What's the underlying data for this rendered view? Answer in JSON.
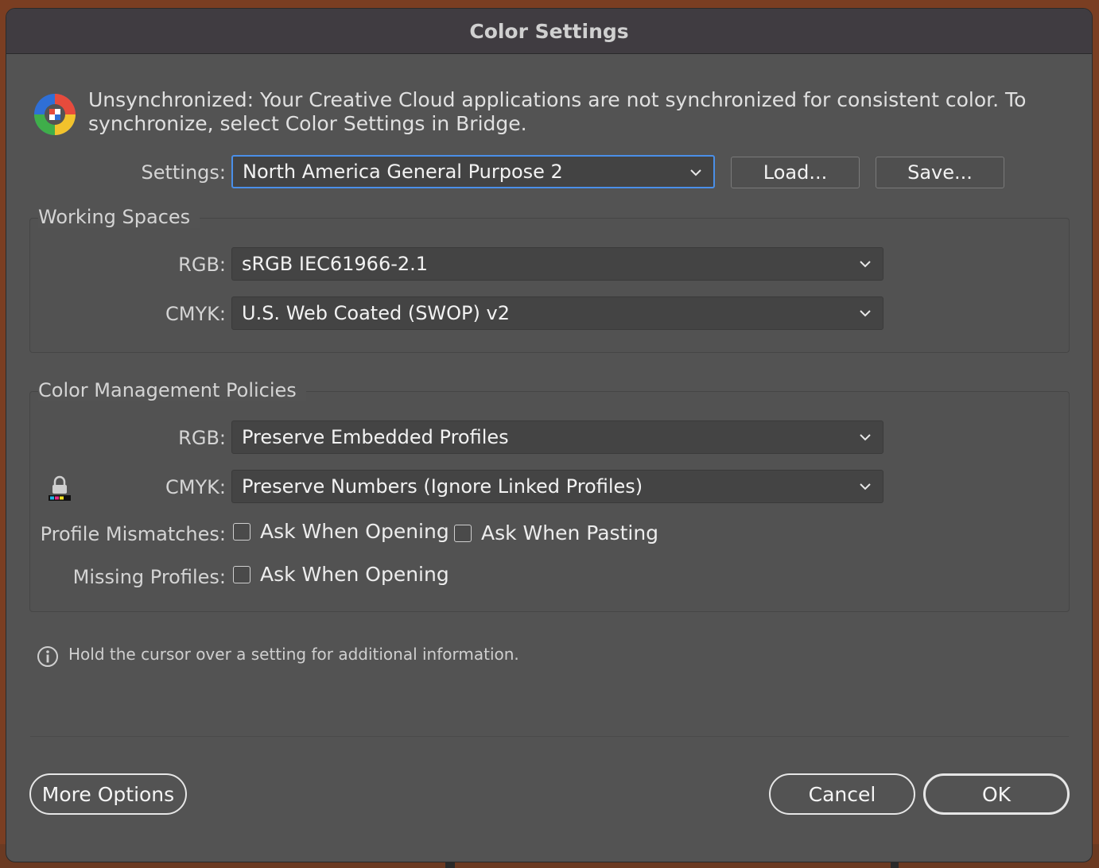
{
  "window": {
    "title": "Color Settings"
  },
  "sync": {
    "icon": "color-sync-icon",
    "message": "Unsynchronized: Your Creative Cloud applications are not synchronized for consistent color. To synchronize, select Color Settings in Bridge."
  },
  "settings": {
    "label": "Settings:",
    "value": "North America General Purpose 2",
    "load_label": "Load...",
    "save_label": "Save..."
  },
  "working_spaces": {
    "title": "Working Spaces",
    "rgb_label": "RGB:",
    "rgb_value": "sRGB IEC61966-2.1",
    "cmyk_label": "CMYK:",
    "cmyk_value": "U.S. Web Coated (SWOP) v2"
  },
  "policies": {
    "title": "Color Management Policies",
    "rgb_label": "RGB:",
    "rgb_value": "Preserve Embedded Profiles",
    "cmyk_label": "CMYK:",
    "cmyk_value": "Preserve Numbers (Ignore Linked Profiles)",
    "mismatch_label": "Profile Mismatches:",
    "mismatch_opening": {
      "label": "Ask When Opening",
      "checked": false
    },
    "mismatch_pasting": {
      "label": "Ask When Pasting",
      "checked": false
    },
    "missing_label": "Missing Profiles:",
    "missing_opening": {
      "label": "Ask When Opening",
      "checked": false
    }
  },
  "info": {
    "text": "Hold the cursor over a setting for additional information."
  },
  "footer": {
    "more_options": "More Options",
    "cancel": "Cancel",
    "ok": "OK"
  },
  "colors": {
    "dialog_bg": "#535353",
    "titlebar_bg": "#403c41",
    "focus_border": "#4a8fe8"
  }
}
